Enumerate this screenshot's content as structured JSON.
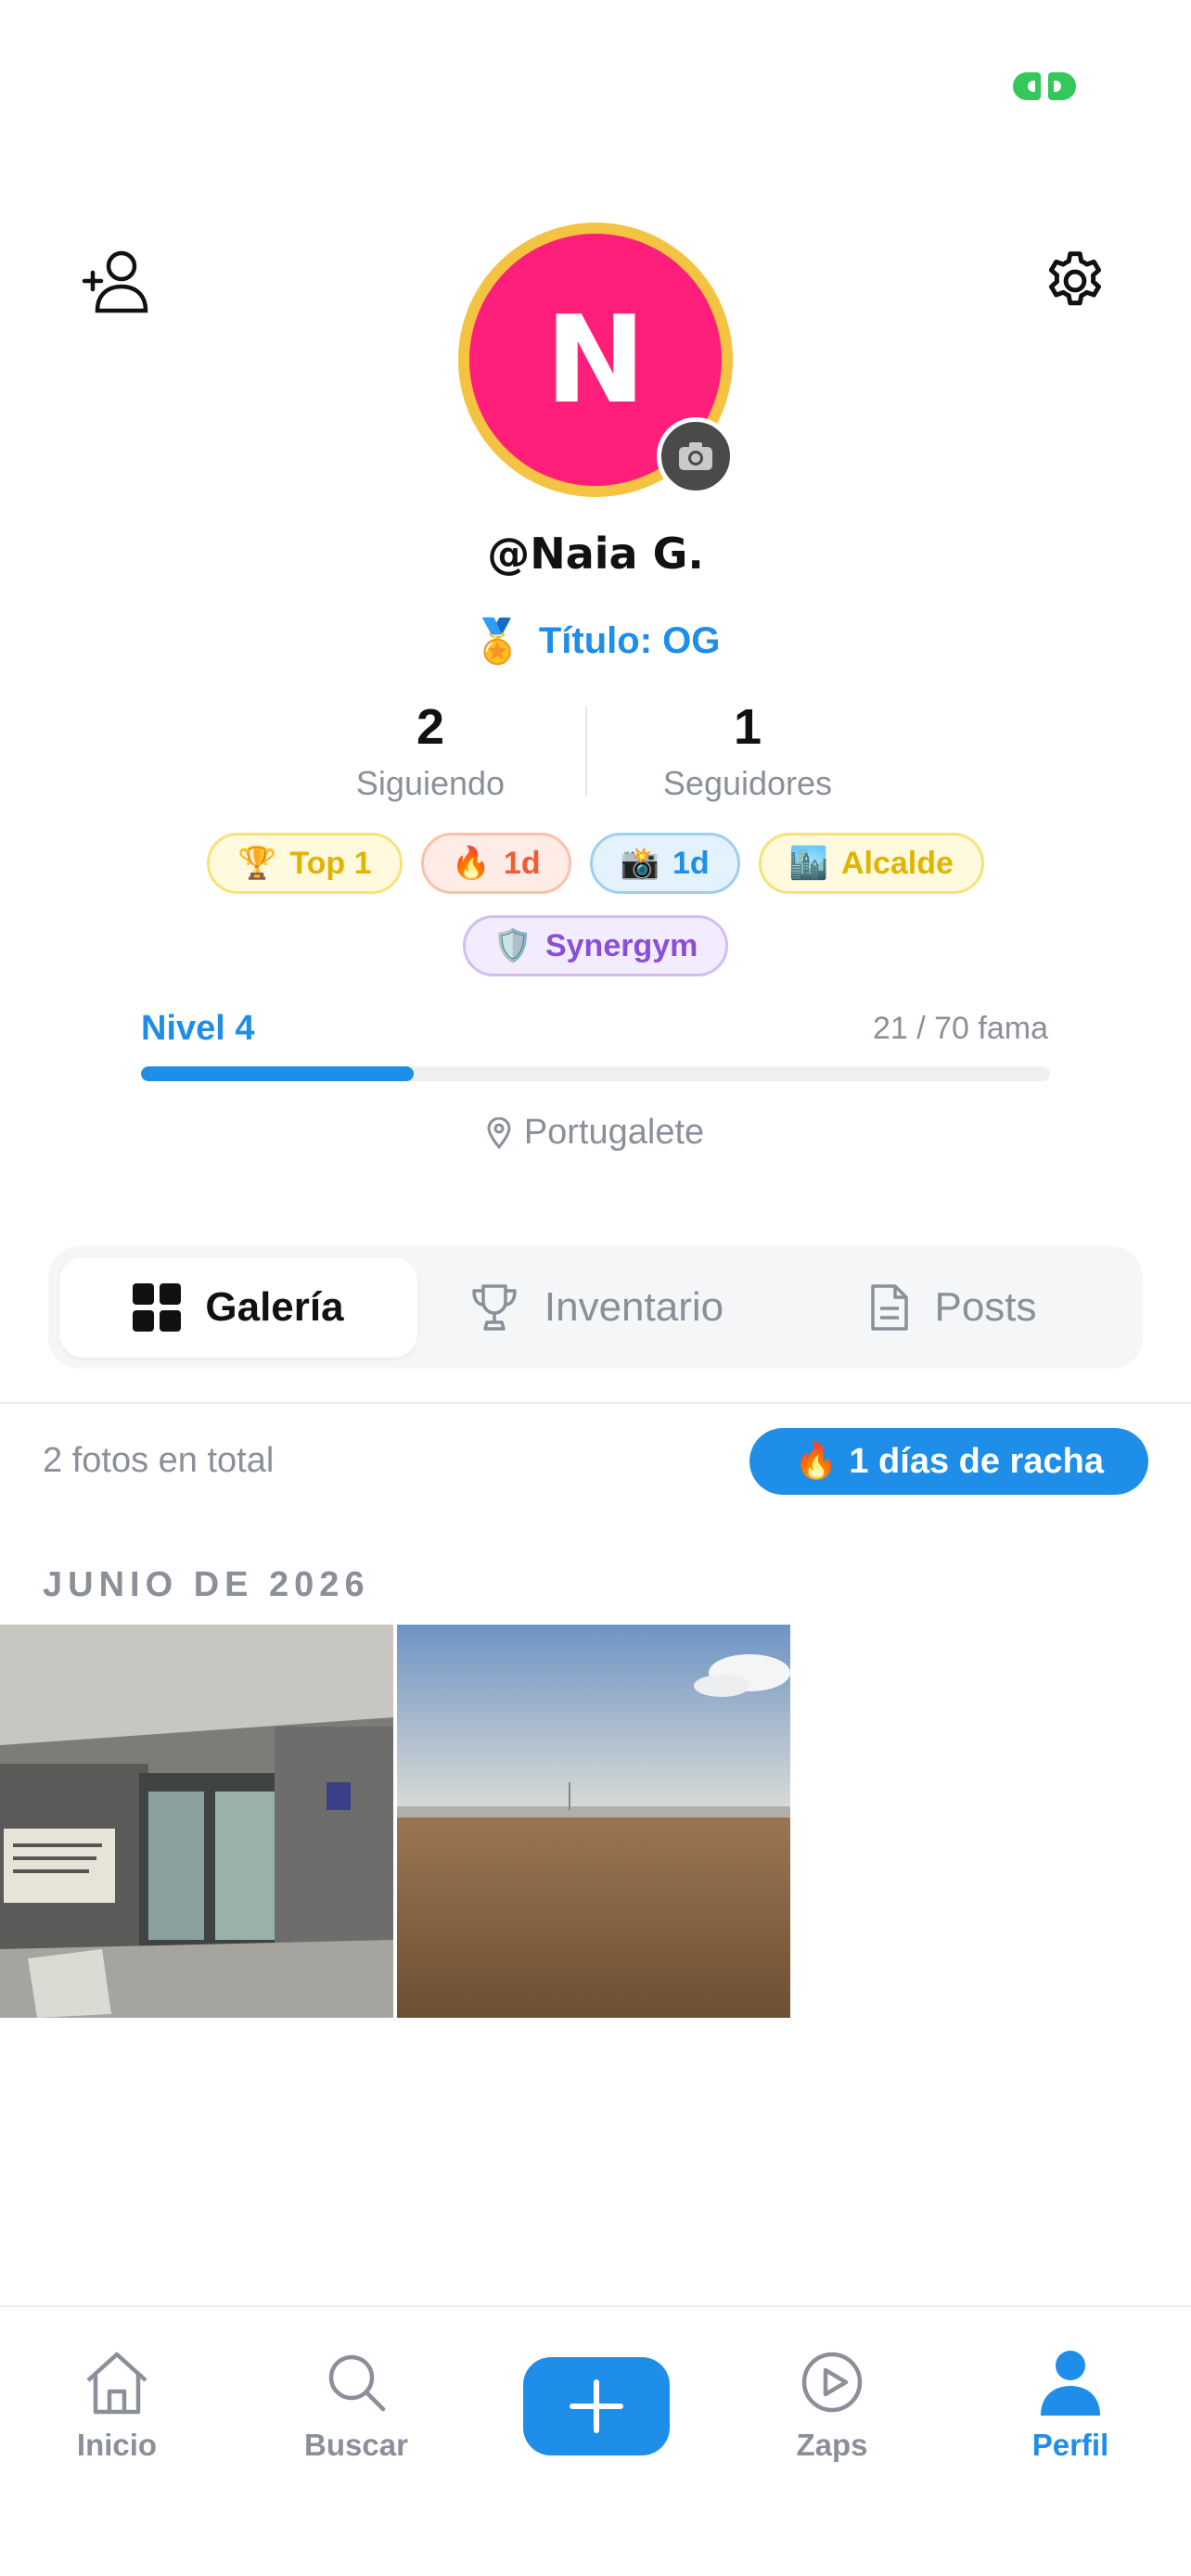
{
  "profile": {
    "avatar_initial": "N",
    "username": "@Naia G.",
    "title_emoji": "🏅",
    "title": "Título: OG"
  },
  "stats": {
    "following_count": "2",
    "following_label": "Siguiendo",
    "followers_count": "1",
    "followers_label": "Seguidores"
  },
  "badges": [
    {
      "emoji": "🏆",
      "label": "Top 1"
    },
    {
      "emoji": "🔥",
      "label": "1d"
    },
    {
      "emoji": "📸",
      "label": "1d"
    },
    {
      "emoji": "🏙️",
      "label": "Alcalde"
    },
    {
      "emoji": "🛡️",
      "label": "Synergym"
    }
  ],
  "level": {
    "label": "Nivel 4",
    "fame_text": "21 / 70 fama",
    "progress_fraction": 0.3
  },
  "location": "Portugalete",
  "tabs": [
    {
      "label": "Galería",
      "icon": "grid-icon",
      "active": true
    },
    {
      "label": "Inventario",
      "icon": "trophy-icon",
      "active": false
    },
    {
      "label": "Posts",
      "icon": "document-icon",
      "active": false
    }
  ],
  "gallery": {
    "total_text": "2 fotos en total",
    "streak_emoji": "🔥",
    "streak_text": "1 días de racha",
    "month_heading": "JUNIO DE 2026",
    "photos": [
      {
        "subject": "station-interior"
      },
      {
        "subject": "beach"
      }
    ]
  },
  "nav": {
    "home": "Inicio",
    "search": "Buscar",
    "zaps": "Zaps",
    "profile": "Perfil"
  },
  "colors": {
    "accent": "#1e8ee9",
    "avatar_bg": "#ff1f7a",
    "avatar_ring": "#f5c342",
    "status_green": "#34c759"
  }
}
